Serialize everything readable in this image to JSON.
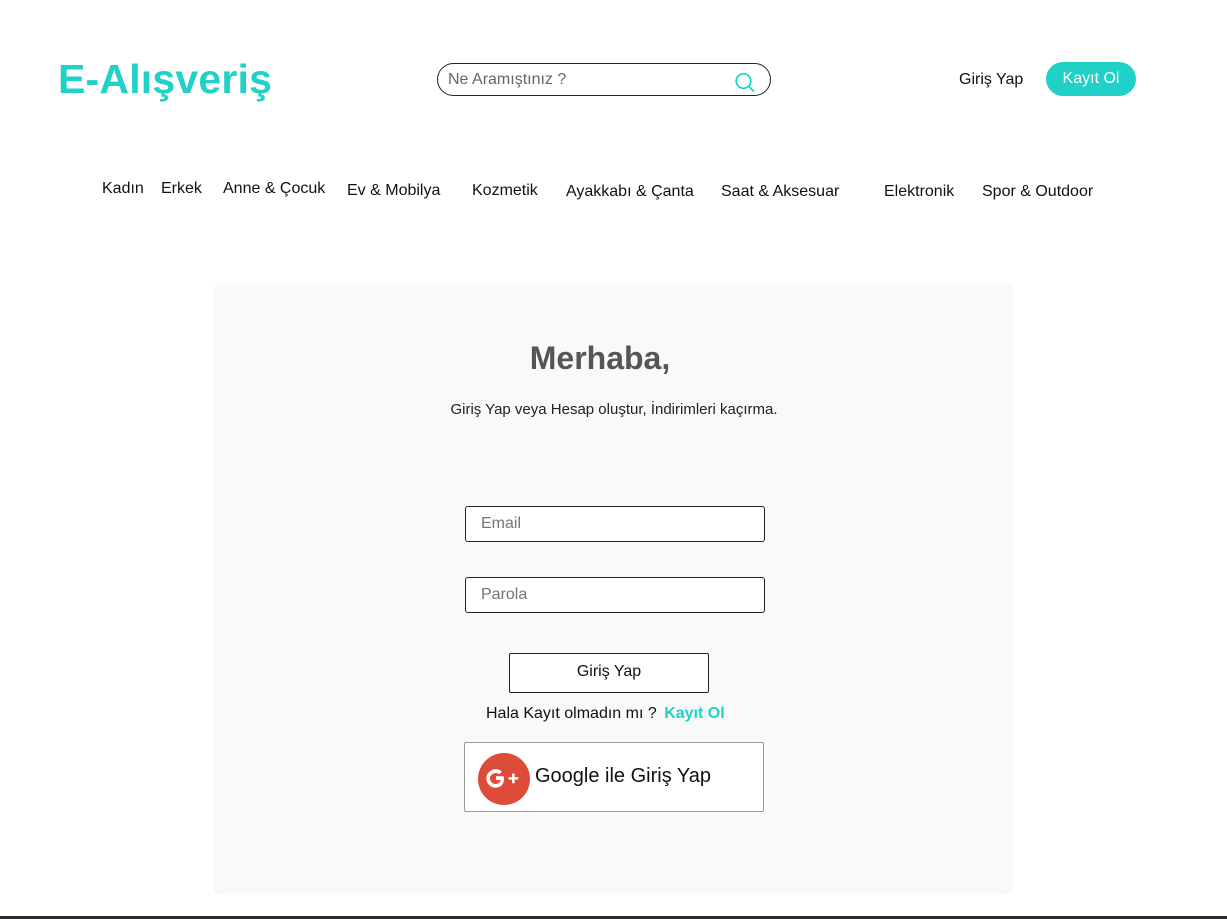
{
  "header": {
    "logo": "E-Alışveriş",
    "search_placeholder": "Ne Aramıştınız ?",
    "search_icon": "search-icon",
    "login_label": "Giriş Yap",
    "signup_label": "Kayıt Ol",
    "accent_color": "#1fd1c6"
  },
  "categories": [
    "Kadın",
    "Erkek",
    "Anne & Çocuk",
    "Ev & Mobilya",
    "Kozmetik",
    "Ayakkabı & Çanta",
    "Saat & Aksesuar",
    "Elektronik",
    "Spor & Outdoor"
  ],
  "login_card": {
    "title": "Merhaba,",
    "subtitle": "Giriş Yap veya Hesap oluştur, İndirimleri kaçırma.",
    "email_placeholder": "Email",
    "password_placeholder": "Parola",
    "submit_label": "Giriş Yap",
    "signup_prompt": "Hala Kayıt olmadın mı ?",
    "signup_link": "Kayıt Ol",
    "google_label": "Google ile Giriş Yap",
    "google_icon": "google-plus-icon",
    "google_color": "#dd4b39"
  }
}
